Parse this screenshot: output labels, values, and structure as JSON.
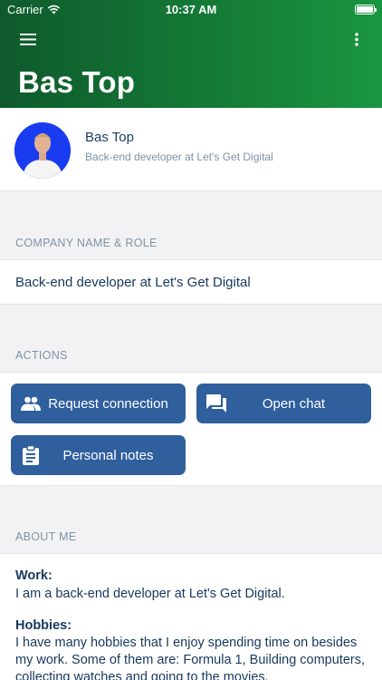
{
  "status_bar": {
    "carrier": "Carrier",
    "time": "10:37 AM"
  },
  "header": {
    "title": "Bas Top"
  },
  "profile": {
    "name": "Bas Top",
    "role": "Back-end developer at Let's Get Digital"
  },
  "company_section": {
    "label": "COMPANY NAME & ROLE",
    "value": "Back-end developer at Let's Get Digital"
  },
  "actions_section": {
    "label": "ACTIONS",
    "buttons": [
      {
        "label": "Request connection",
        "icon": "people-icon"
      },
      {
        "label": "Open chat",
        "icon": "chat-icon"
      },
      {
        "label": "Personal notes",
        "icon": "clipboard-icon"
      }
    ]
  },
  "about_section": {
    "label": "ABOUT ME",
    "work_heading": "Work:",
    "work_text": "I am a back-end developer at Let's Get Digital.",
    "hobbies_heading": "Hobbies:",
    "hobbies_text": "I have many hobbies that I enjoy spending time on besides my work. Some of them are: Formula 1, Building computers, collecting watches and going to the movies."
  },
  "colors": {
    "header_start": "#0f5a2c",
    "header_end": "#1a9640",
    "button": "#2f5f9d",
    "text_dark": "#17385e",
    "text_muted": "#7f93a6"
  }
}
